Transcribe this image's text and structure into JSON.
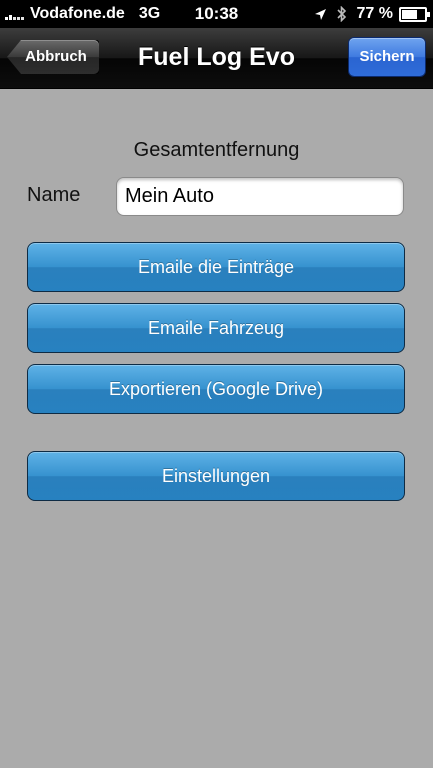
{
  "status_bar": {
    "carrier": "Vodafone.de",
    "network": "3G",
    "time": "10:38",
    "battery_percent": "77 %",
    "battery_level": 0.77,
    "icons": [
      "signal-icon",
      "location-icon",
      "bluetooth-icon",
      "battery-icon"
    ]
  },
  "nav_bar": {
    "back_label": "Abbruch",
    "title": "Fuel Log Evo",
    "save_label": "Sichern"
  },
  "main": {
    "section_title": "Gesamtentfernung",
    "name_label": "Name",
    "name_value": "Mein Auto",
    "buttons": {
      "email_entries": "Emaile die Einträge",
      "email_vehicle": "Emaile Fahrzeug",
      "export_drive": "Exportieren (Google Drive)",
      "settings": "Einstellungen"
    }
  },
  "colors": {
    "background": "#ababab",
    "nav_bar": "#171717",
    "save_button": "#3f7ae0",
    "action_button": "#3692cf"
  }
}
